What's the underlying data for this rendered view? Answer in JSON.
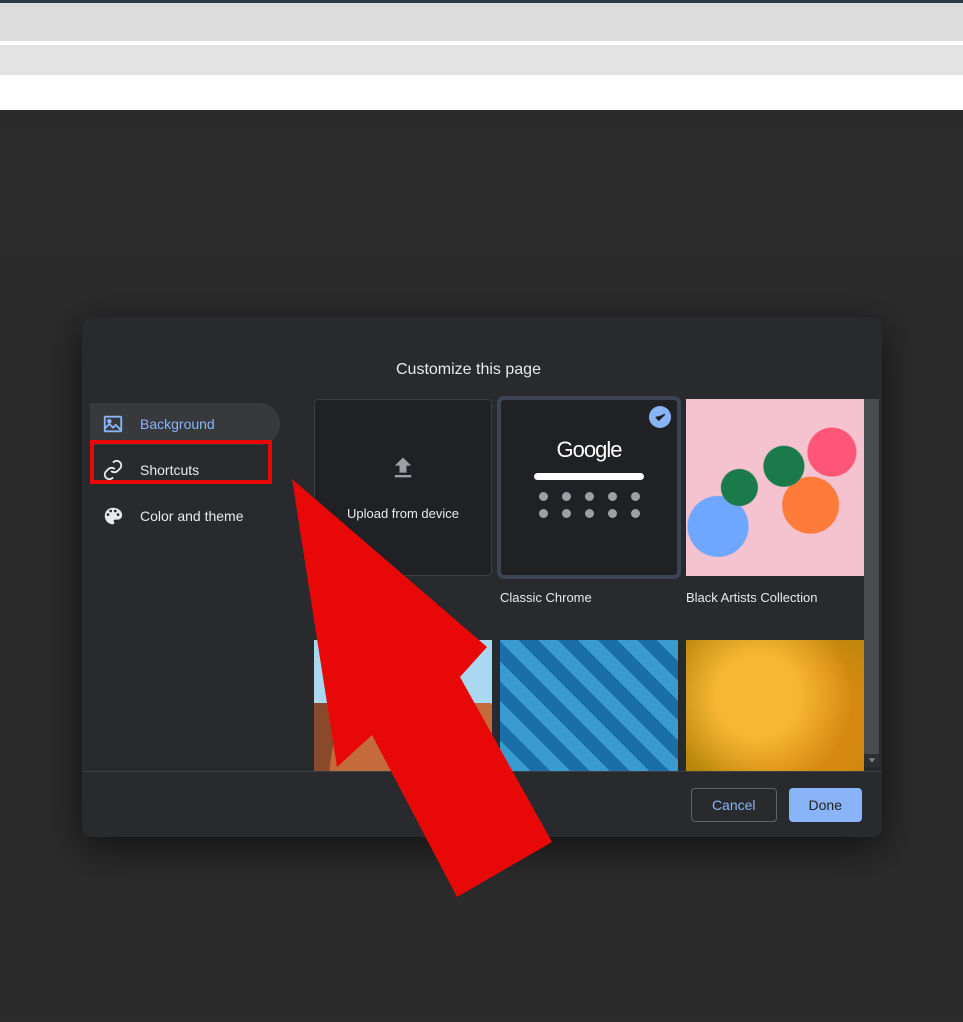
{
  "dialog": {
    "title": "Customize this page",
    "sidebar": {
      "items": [
        {
          "label": "Background",
          "icon": "picture-icon",
          "active": true
        },
        {
          "label": "Shortcuts",
          "icon": "link-icon",
          "active": false,
          "highlighted": true
        },
        {
          "label": "Color and theme",
          "icon": "palette-icon",
          "active": false
        }
      ]
    },
    "tiles": {
      "upload": {
        "label": "Upload from device"
      },
      "classic": {
        "label": "Classic Chrome",
        "preview_text": "Google",
        "selected": true
      },
      "black_artists": {
        "label": "Black Artists Collection"
      }
    },
    "footer": {
      "cancel": "Cancel",
      "done": "Done"
    }
  },
  "background_logo": "Google"
}
